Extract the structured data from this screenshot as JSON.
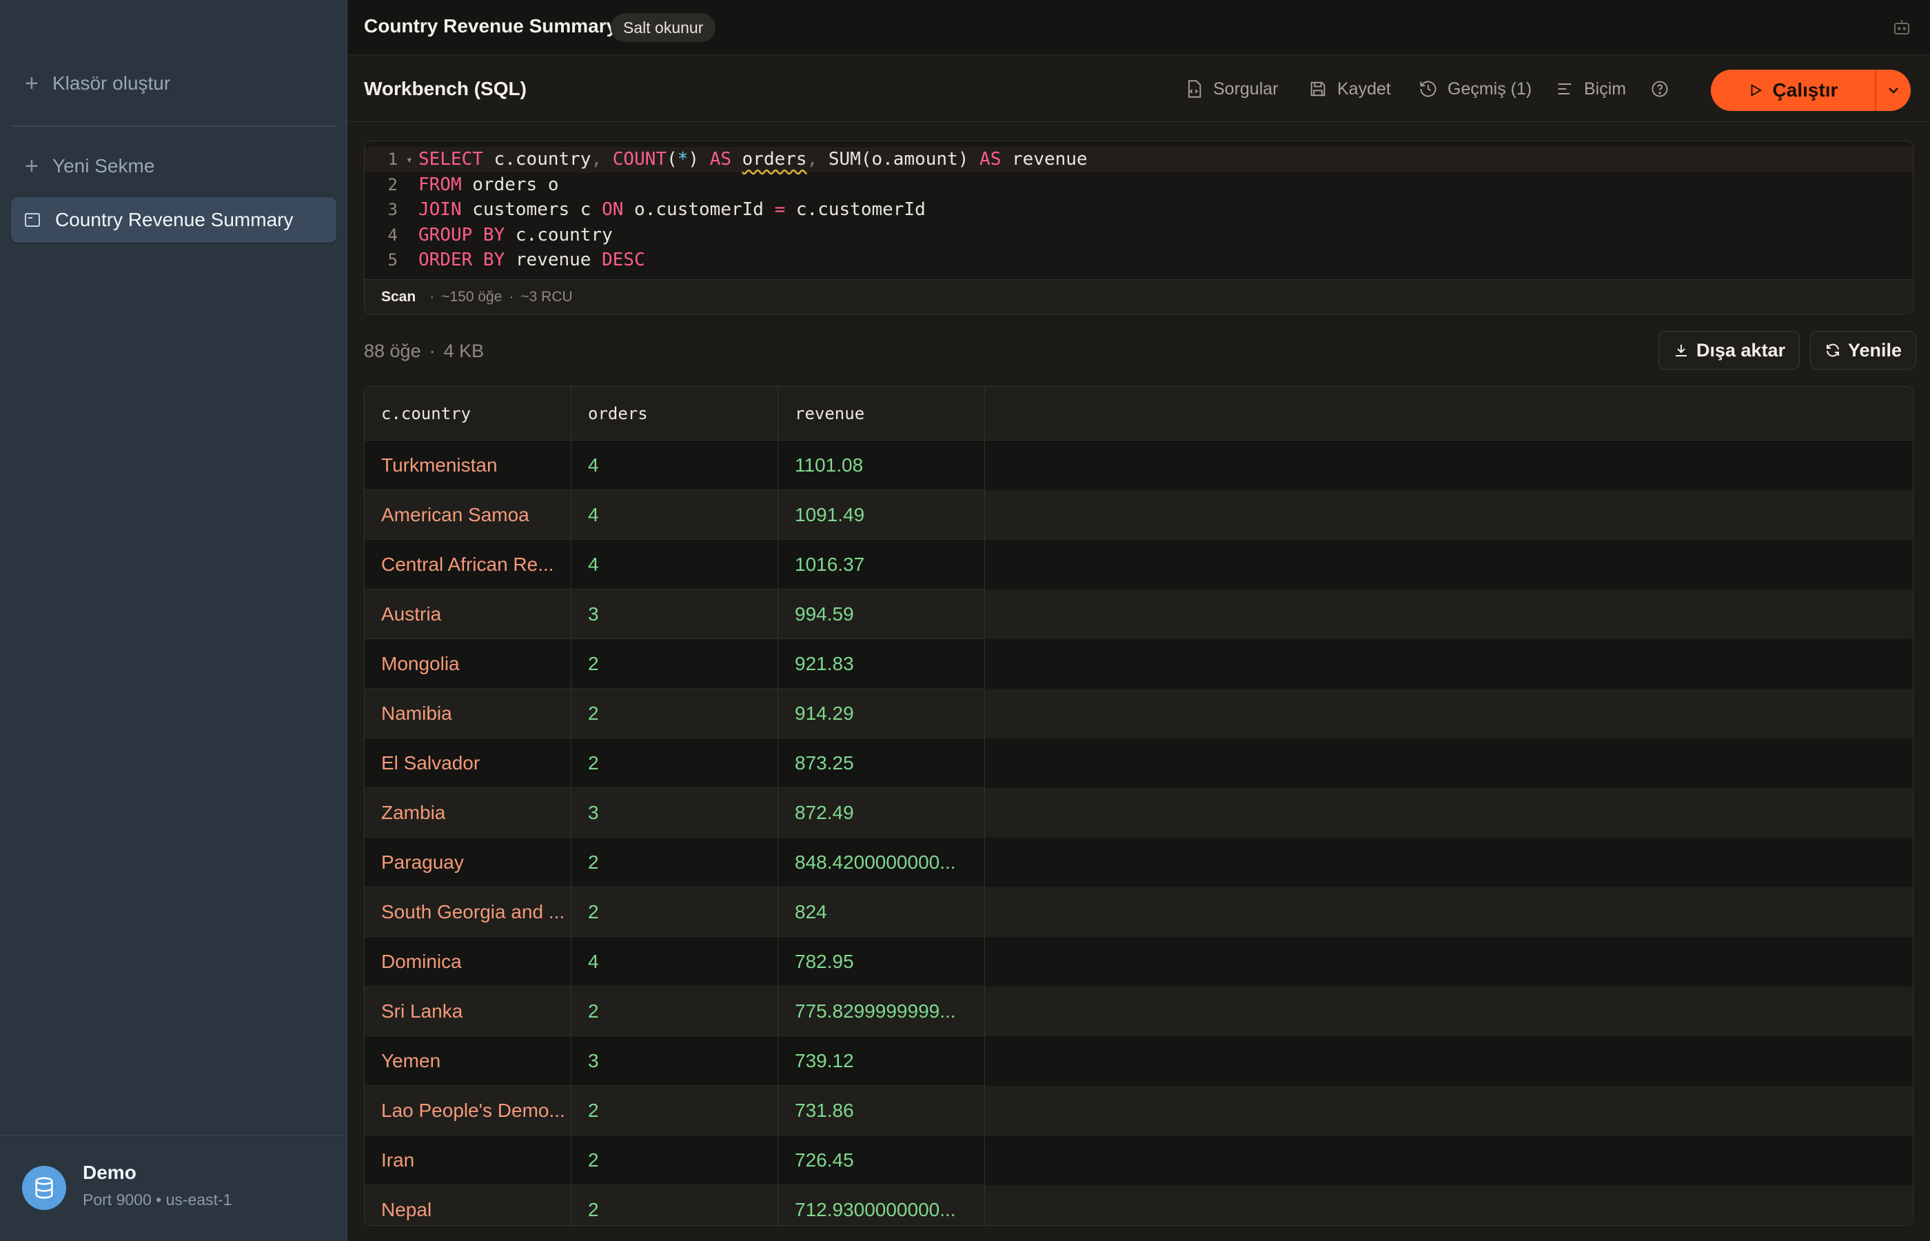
{
  "sidebar": {
    "create_folder": "Klasör oluştur",
    "new_tab": "Yeni Sekme",
    "active_tab": "Country Revenue Summary",
    "connection": {
      "name": "Demo",
      "details": "Port 9000 • us-east-1"
    }
  },
  "topbar": {
    "title": "Country Revenue Summary",
    "badge": "Salt okunur"
  },
  "toolbar": {
    "title": "Workbench (SQL)",
    "queries": "Sorgular",
    "save": "Kaydet",
    "history": "Geçmiş (1)",
    "format": "Biçim",
    "run": "Çalıştır"
  },
  "editor": {
    "line_numbers": [
      "1",
      "2",
      "3",
      "4",
      "5"
    ],
    "status": {
      "mode": "Scan",
      "items": "~150 öğe",
      "cost": "~3 RCU"
    }
  },
  "results": {
    "count": "88 öğe",
    "size": "4 KB",
    "export_label": "Dışa aktar",
    "refresh_label": "Yenile",
    "columns": [
      "c.country",
      "orders",
      "revenue"
    ],
    "rows": [
      [
        "Turkmenistan",
        "4",
        "1101.08"
      ],
      [
        "American Samoa",
        "4",
        "1091.49"
      ],
      [
        "Central African Re...",
        "4",
        "1016.37"
      ],
      [
        "Austria",
        "3",
        "994.59"
      ],
      [
        "Mongolia",
        "2",
        "921.83"
      ],
      [
        "Namibia",
        "2",
        "914.29"
      ],
      [
        "El Salvador",
        "2",
        "873.25"
      ],
      [
        "Zambia",
        "3",
        "872.49"
      ],
      [
        "Paraguay",
        "2",
        "848.4200000000..."
      ],
      [
        "South Georgia and ...",
        "2",
        "824"
      ],
      [
        "Dominica",
        "4",
        "782.95"
      ],
      [
        "Sri Lanka",
        "2",
        "775.8299999999..."
      ],
      [
        "Yemen",
        "3",
        "739.12"
      ],
      [
        "Lao People's Demo...",
        "2",
        "731.86"
      ],
      [
        "Iran",
        "2",
        "726.45"
      ],
      [
        "Nepal",
        "2",
        "712.9300000000..."
      ]
    ]
  }
}
